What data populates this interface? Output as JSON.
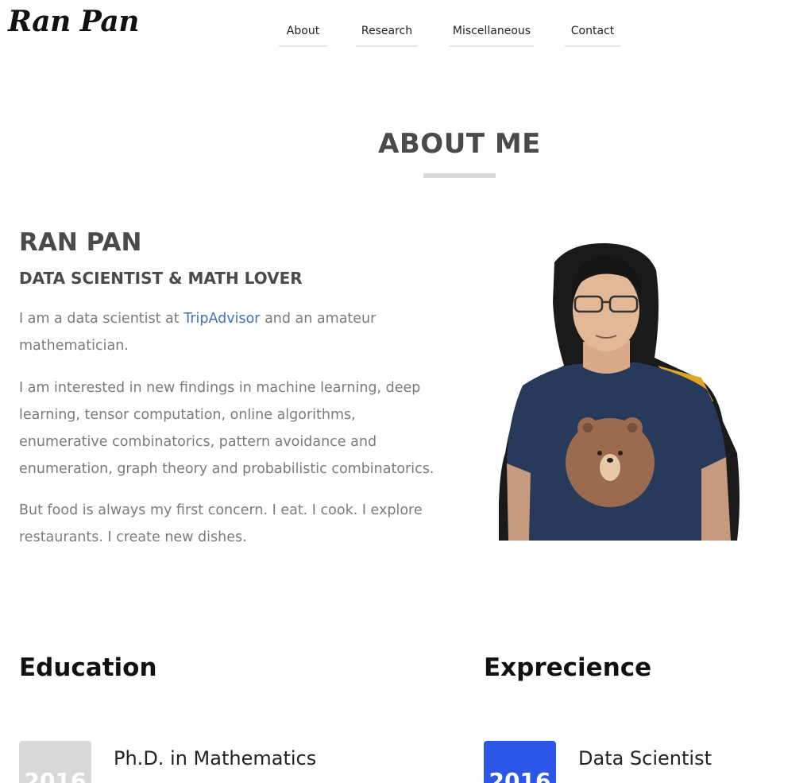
{
  "header": {
    "logo": "Ran Pan",
    "nav": [
      "About",
      "Research",
      "Miscellaneous",
      "Contact"
    ]
  },
  "about": {
    "section_title": "ABOUT ME",
    "name": "RAN PAN",
    "subtitle": "DATA SCIENTIST & MATH LOVER",
    "para1_before": "I am a data scientist at ",
    "para1_link": "TripAdvisor",
    "para1_after": " and an amateur mathematician.",
    "para2": "I am interested in new findings in machine learning, deep learning, tensor computation, online algorithms, enumerative combinatorics, pattern avoidance and enumeration, graph theory and probabilistic combinatorics.",
    "para3": "But food is always my first concern. I eat. I cook. I explore restaurants. I create new dishes."
  },
  "education": {
    "heading": "Education",
    "items": [
      {
        "year": "2016",
        "title": "Ph.D. in Mathematics"
      }
    ]
  },
  "experience": {
    "heading": "Exprecience",
    "items": [
      {
        "year": "2016",
        "title": "Data Scientist"
      }
    ]
  },
  "colors": {
    "link": "#3f74b8",
    "experience_year_bg": "#2c56e8",
    "education_year_bg": "#d9d9d9"
  }
}
